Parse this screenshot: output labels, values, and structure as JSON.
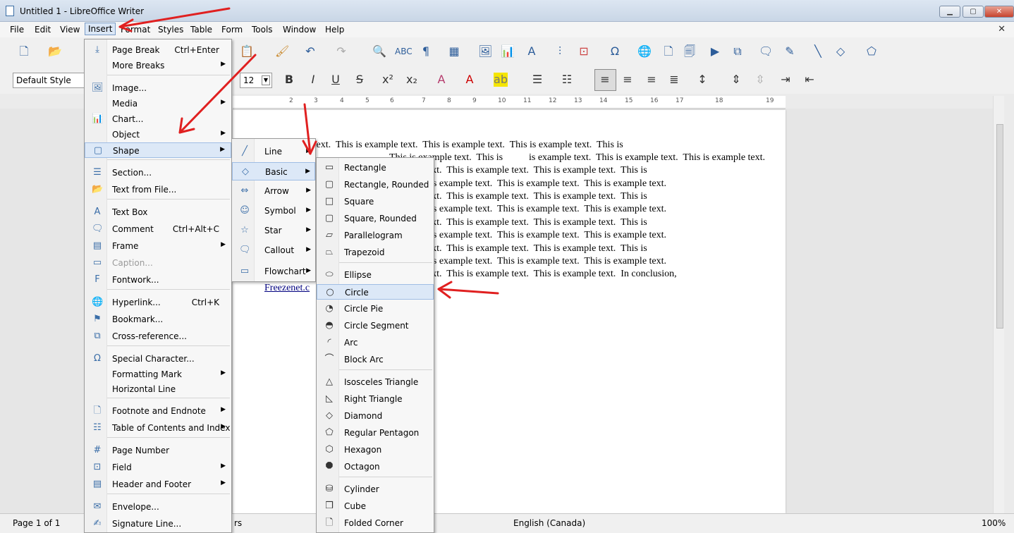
{
  "window": {
    "title": "Untitled 1 - LibreOffice Writer"
  },
  "menubar": [
    "File",
    "Edit",
    "View",
    "Insert",
    "Format",
    "Styles",
    "Table",
    "Form",
    "Tools",
    "Window",
    "Help"
  ],
  "toolbar": {
    "paragraph_style": "Default Style",
    "font_size": "12"
  },
  "ruler": {
    "ticks": [
      "2",
      "3",
      "4",
      "5",
      "6",
      "7",
      "8",
      "9",
      "10",
      "11",
      "12",
      "13",
      "14",
      "15",
      "16",
      "17",
      "18",
      "19"
    ]
  },
  "document": {
    "lines": [
      "ple text.  This is example text.  This is example text.  This is example text.  This is",
      "is example text.  This is example text.  This is example text.",
      "text.  This is example text.  This is example text.  This is",
      "is example text.  This is example text.  This is example text.",
      "text.  This is example text.  This is example text.  This is",
      "is example text.  This is example text.  This is example text.",
      "text.  This is example text.  This is example text.  This is",
      "is example text.  This is example text.  This is example text.",
      "text.  This is example text.  This is example text.  This is",
      "is example text.  This is example text.  This is example text.",
      "text.  This is example text.  This is example text.  In conclusion,"
    ],
    "link": "Freezenet.c",
    "line2_fragment": "This is example text.  This is"
  },
  "insert_menu": {
    "items": [
      {
        "label": "Page Break",
        "shortcut": "Ctrl+Enter",
        "icon": "page-break-icon"
      },
      {
        "label": "More Breaks",
        "submenu": true
      },
      {
        "label": "Image...",
        "icon": "image-icon"
      },
      {
        "label": "Media",
        "submenu": true
      },
      {
        "label": "Chart...",
        "icon": "chart-icon"
      },
      {
        "label": "Object",
        "submenu": true
      },
      {
        "label": "Shape",
        "submenu": true,
        "icon": "shape-icon"
      },
      {
        "label": "Section...",
        "icon": "section-icon"
      },
      {
        "label": "Text from File...",
        "icon": "folder-icon"
      },
      {
        "label": "Text Box",
        "icon": "text-box-icon"
      },
      {
        "label": "Comment",
        "shortcut": "Ctrl+Alt+C",
        "icon": "comment-icon"
      },
      {
        "label": "Frame",
        "submenu": true,
        "icon": "frame-icon"
      },
      {
        "label": "Caption...",
        "disabled": true,
        "icon": "caption-icon"
      },
      {
        "label": "Fontwork...",
        "icon": "fontwork-icon"
      },
      {
        "label": "Hyperlink...",
        "shortcut": "Ctrl+K",
        "icon": "hyperlink-icon"
      },
      {
        "label": "Bookmark...",
        "icon": "bookmark-icon"
      },
      {
        "label": "Cross-reference...",
        "icon": "cross-reference-icon"
      },
      {
        "label": "Special Character...",
        "icon": "omega-icon"
      },
      {
        "label": "Formatting Mark",
        "submenu": true
      },
      {
        "label": "Horizontal Line"
      },
      {
        "label": "Footnote and Endnote",
        "submenu": true,
        "icon": "footnote-icon"
      },
      {
        "label": "Table of Contents and Index",
        "submenu": true,
        "icon": "toc-icon"
      },
      {
        "label": "Page Number",
        "icon": "page-number-icon"
      },
      {
        "label": "Field",
        "submenu": true,
        "icon": "field-icon"
      },
      {
        "label": "Header and Footer",
        "submenu": true,
        "icon": "header-footer-icon"
      },
      {
        "label": "Envelope...",
        "icon": "envelope-icon"
      },
      {
        "label": "Signature Line...",
        "icon": "signature-icon"
      }
    ]
  },
  "shape_menu": {
    "items": [
      {
        "label": "Line",
        "icon": "line-icon"
      },
      {
        "label": "Basic",
        "icon": "diamond-icon"
      },
      {
        "label": "Arrow",
        "icon": "arrow-shape-icon"
      },
      {
        "label": "Symbol",
        "icon": "smiley-icon"
      },
      {
        "label": "Star",
        "icon": "star-icon"
      },
      {
        "label": "Callout",
        "icon": "callout-icon"
      },
      {
        "label": "Flowchart",
        "icon": "flowchart-icon"
      }
    ]
  },
  "basic_menu": {
    "items": [
      {
        "label": "Rectangle",
        "icon": "rectangle-icon"
      },
      {
        "label": "Rectangle, Rounded",
        "icon": "rounded-rectangle-icon"
      },
      {
        "label": "Square",
        "icon": "square-icon"
      },
      {
        "label": "Square, Rounded",
        "icon": "rounded-square-icon"
      },
      {
        "label": "Parallelogram",
        "icon": "parallelogram-icon"
      },
      {
        "label": "Trapezoid",
        "icon": "trapezoid-icon"
      },
      {
        "label": "Ellipse",
        "icon": "ellipse-icon"
      },
      {
        "label": "Circle",
        "icon": "circle-icon"
      },
      {
        "label": "Circle Pie",
        "icon": "circle-pie-icon"
      },
      {
        "label": "Circle Segment",
        "icon": "circle-segment-icon"
      },
      {
        "label": "Arc",
        "icon": "arc-icon"
      },
      {
        "label": "Block Arc",
        "icon": "block-arc-icon"
      },
      {
        "label": "Isosceles Triangle",
        "icon": "isosceles-triangle-icon"
      },
      {
        "label": "Right Triangle",
        "icon": "right-triangle-icon"
      },
      {
        "label": "Diamond",
        "icon": "diamond-icon"
      },
      {
        "label": "Regular Pentagon",
        "icon": "pentagon-icon"
      },
      {
        "label": "Hexagon",
        "icon": "hexagon-icon"
      },
      {
        "label": "Octagon",
        "icon": "octagon-icon"
      },
      {
        "label": "Cylinder",
        "icon": "cylinder-icon"
      },
      {
        "label": "Cube",
        "icon": "cube-icon"
      },
      {
        "label": "Folded Corner",
        "icon": "folded-corner-icon"
      }
    ]
  },
  "statusbar": {
    "page": "Page 1 of 1",
    "words_fragment": "rs",
    "language": "English (Canada)",
    "zoom": "100%"
  },
  "colors": {
    "annotation": "#e02020",
    "highlight": "#dce8f7"
  }
}
